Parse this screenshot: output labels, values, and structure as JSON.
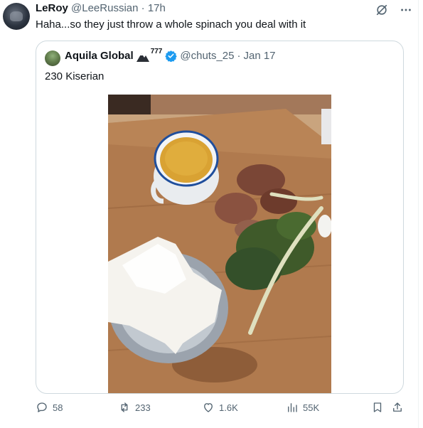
{
  "tweet": {
    "author_name": "LeRoy",
    "author_handle": "@LeeRussian",
    "separator": "·",
    "time": "17h",
    "text": "Haha...so they just throw a whole spinach you deal with it"
  },
  "quote": {
    "author_name": "Aquila Global",
    "emoji_suffix": "777",
    "author_handle": "@chuts_25",
    "separator": "·",
    "date": "Jan 17",
    "text": "230 Kiserian"
  },
  "actions": {
    "replies": "58",
    "reposts": "233",
    "likes": "1.6K",
    "views": "55K"
  },
  "colors": {
    "text_primary": "#0f1419",
    "text_secondary": "#536471",
    "verified_blue": "#1d9bf0",
    "border": "#cfd9de"
  },
  "icons": [
    "grok-icon",
    "more-icon",
    "verified-icon",
    "reply-icon",
    "repost-icon",
    "like-icon",
    "views-icon",
    "bookmark-icon",
    "share-icon"
  ]
}
